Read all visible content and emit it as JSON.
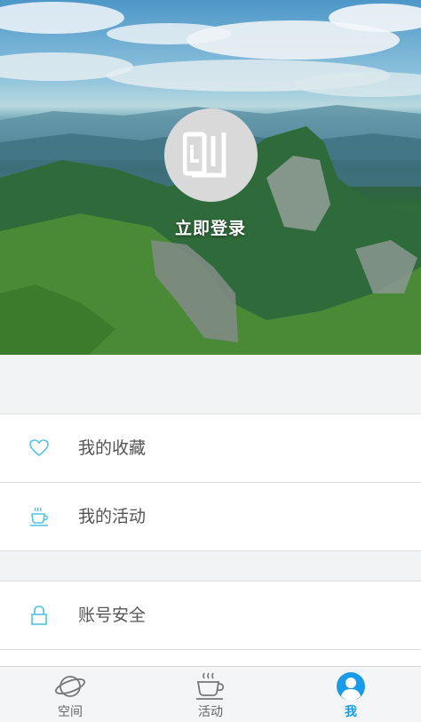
{
  "header": {
    "login_label": "立即登录",
    "avatar_icon": "app-logo-icon"
  },
  "menu_primary": [
    {
      "label": "我的收藏",
      "icon": "heart-icon"
    },
    {
      "label": "我的活动",
      "icon": "coffee-cup-icon"
    }
  ],
  "menu_secondary": [
    {
      "label": "账号安全",
      "icon": "lock-icon"
    }
  ],
  "tabs": [
    {
      "label": "空间",
      "icon": "planet-icon",
      "active": false
    },
    {
      "label": "活动",
      "icon": "coffee-cup-icon",
      "active": false
    },
    {
      "label": "我",
      "icon": "user-icon",
      "active": true
    }
  ],
  "colors": {
    "accent": "#1a9be8",
    "icon_stroke": "#4fc3e8",
    "background": "#f2f3f4"
  }
}
